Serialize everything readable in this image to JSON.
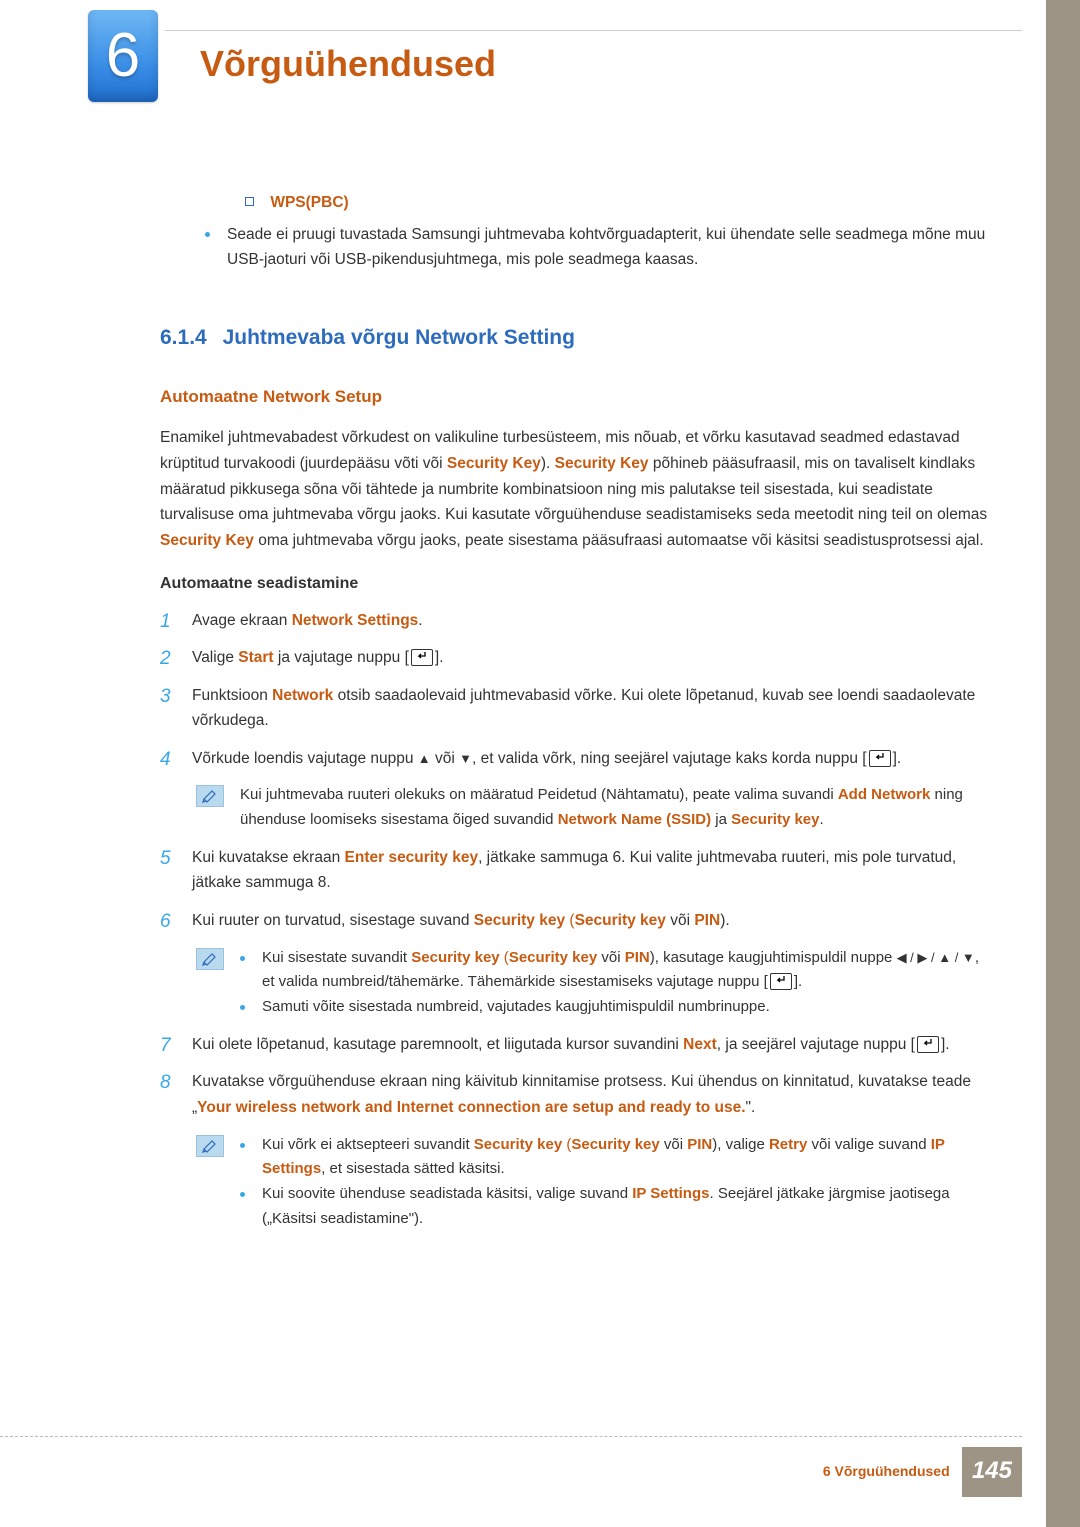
{
  "chapter": {
    "number": "6",
    "title": "Võrguühendused"
  },
  "wps": {
    "label": "WPS(PBC)",
    "bullet": "Seade ei pruugi tuvastada Samsungi juhtmevaba kohtvõrguadapterit, kui ühendate selle seadmega mõne muu USB-jaoturi või USB-pikendusjuhtmega, mis pole seadmega kaasas."
  },
  "section": {
    "num": "6.1.4",
    "title": "Juhtmevaba võrgu Network Setting"
  },
  "auto": {
    "heading": "Automaatne Network Setup",
    "para_a": "Enamikel juhtmevabadest võrkudest on valikuline turbesüsteem, mis nõuab, et võrku kasutavad seadmed edastavad krüptitud turvakoodi (juurdepääsu võti või ",
    "sk": "Security Key",
    "para_b": "). ",
    "para_c": " põhineb pääsufraasil, mis on tavaliselt kindlaks määratud pikkusega sõna või tähtede ja numbrite kombinatsioon ning mis palutakse teil sisestada, kui seadistate turvalisuse oma juhtmevaba võrgu jaoks. Kui kasutate võrguühenduse seadistamiseks seda meetodit ning teil on olemas ",
    "para_d": " oma juhtmevaba võrgu jaoks, peate sisestama pääsufraasi automaatse või käsitsi seadistusprotsessi ajal.",
    "sub2": "Automaatne seadistamine"
  },
  "steps": {
    "s1_a": "Avage ekraan ",
    "s1_b": "Network Settings",
    "s1_c": ".",
    "s2_a": "Valige ",
    "s2_b": "Start",
    "s2_c": " ja vajutage nuppu [",
    "s2_d": "].",
    "s3_a": "Funktsioon ",
    "s3_b": "Network",
    "s3_c": " otsib saadaolevaid juhtmevabasid võrke. Kui olete lõpetanud, kuvab see loendi saadaolevate võrkudega.",
    "s4_a": "Võrkude loendis vajutage nuppu ",
    "s4_b": " või ",
    "s4_c": ", et valida võrk, ning seejärel vajutage kaks korda nuppu [",
    "s4_d": "].",
    "note1_a": "Kui juhtmevaba ruuteri olekuks on määratud Peidetud (Nähtamatu), peate valima suvandi ",
    "note1_b": "Add Network",
    "note1_c": " ning ühenduse loomiseks sisestama õiged suvandid ",
    "note1_d": "Network Name (SSID)",
    "note1_e": " ja ",
    "note1_f": "Security key",
    "note1_g": ".",
    "s5_a": "Kui kuvatakse ekraan ",
    "s5_b": "Enter security key",
    "s5_c": ", jätkake sammuga 6. Kui valite juhtmevaba ruuteri, mis pole turvatud, jätkake sammuga 8.",
    "s6_a": "Kui ruuter on turvatud, sisestage suvand ",
    "s6_b": "Security key",
    "s6_c": " (",
    "s6_d": " või ",
    "s6_e": "PIN",
    "s6_f": ").",
    "note2a_a": "Kui sisestate suvandit ",
    "note2a_c": "), kasutage kaugjuhtimispuldil nuppe ",
    "note2a_d": ", et valida numbreid/tähemärke. Tähemärkide sisestamiseks vajutage nuppu [",
    "note2a_e": "].",
    "note2b": "Samuti võite sisestada numbreid, vajutades kaugjuhtimispuldil numbrinuppe.",
    "s7_a": "Kui olete lõpetanud, kasutage paremnoolt, et liigutada kursor suvandini ",
    "s7_b": "Next",
    "s7_c": ", ja seejärel vajutage nuppu [",
    "s7_d": "].",
    "s8_a": "Kuvatakse võrguühenduse ekraan ning käivitub kinnitamise protsess. Kui ühendus on kinnitatud, kuvatakse teade „",
    "s8_b": "Your wireless network and Internet connection are setup and ready to use.",
    "s8_c": "\".",
    "note3a_a": "Kui võrk ei aktsepteeri suvandit ",
    "note3a_b": "), valige ",
    "note3a_c": "Retry",
    "note3a_d": " või valige suvand ",
    "note3a_e": "IP Settings",
    "note3a_f": ", et sisestada sätted käsitsi.",
    "note3b_a": "Kui soovite ühenduse seadistada käsitsi, valige suvand ",
    "note3b_b": ". Seejärel jätkake järgmise jaotisega („Käsitsi seadistamine\")."
  },
  "footer": {
    "label": "6 Võrguühendused",
    "page": "145"
  }
}
